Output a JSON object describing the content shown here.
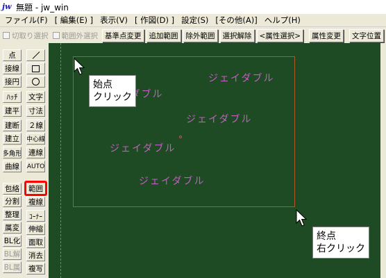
{
  "window": {
    "app_icon": "jw",
    "title": "無題 - jw_win"
  },
  "menu": [
    "ファイル(F)",
    "[ 編集(E) ]",
    "表示(V)",
    "[ 作図(D) ]",
    "設定(S)",
    "[その他(A)]",
    "ヘルプ(H)"
  ],
  "toolbar": {
    "check_cut_select": "切取り選択",
    "check_out_range_select": "範囲外選択",
    "btn_base_point_change": "基準点変更",
    "btn_add_range": "追加範囲",
    "btn_exclude_range": "除外範囲",
    "btn_clear_selection": "選択解除",
    "btn_attr_select": "<属性選択>",
    "btn_attr_change": "属性変更",
    "btn_text_position": "文字位置"
  },
  "tools": {
    "point": "点",
    "tangent": "接線",
    "tangent_circle": "接円",
    "hatch": "ﾊｯﾁ",
    "text": "文字",
    "dimension": "寸法",
    "elevation": "建平",
    "double_line": "２線",
    "section": "建断",
    "center_line": "中心線",
    "standing": "建立",
    "continuous_line": "連線",
    "polygon": "多角形",
    "auto": "AUTO",
    "curve": "曲線",
    "include": "包絡",
    "range": "範囲",
    "divide": "分割",
    "copy_line": "複線",
    "organize": "整理",
    "corner": "ｺｰﾅｰ",
    "attr_change": "属変",
    "stretch": "伸縮",
    "bl_make": "BL化",
    "chamfer": "面取",
    "bl_release": "BL解",
    "erase": "消去",
    "bl_attr": "BL属",
    "duplicate": "複写"
  },
  "canvas": {
    "texts": [
      "ジェイダブル",
      "ジェイダブル",
      "ジェイダブル",
      "ジェイダブル",
      "ジェイダブル"
    ],
    "callout_start": [
      "始点",
      "クリック"
    ],
    "callout_end": [
      "終点",
      "右クリック"
    ]
  },
  "colors": {
    "canvas_bg": "#1e4a24",
    "cad_text": "#c060c0",
    "selection_rect": "#b05828",
    "highlight": "#ff0000"
  }
}
